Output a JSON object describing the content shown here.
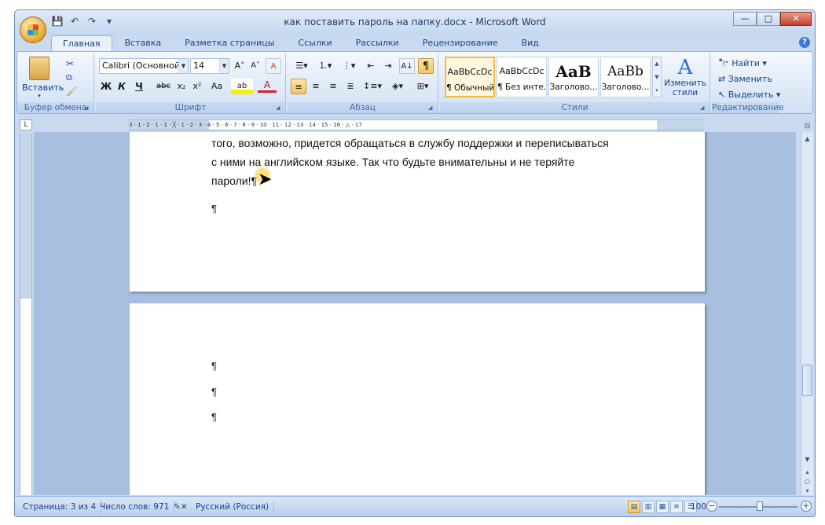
{
  "window": {
    "title": "как поставить пароль на папку.docx - Microsoft Word",
    "controls": {
      "minimize": "—",
      "maximize": "□",
      "close": "✕"
    }
  },
  "qat": {
    "save": "💾",
    "undo": "↶",
    "redo": "↷",
    "more": "▾"
  },
  "tabs": [
    "Главная",
    "Вставка",
    "Разметка страницы",
    "Ссылки",
    "Рассылки",
    "Рецензирование",
    "Вид"
  ],
  "active_tab": "Главная",
  "ribbon": {
    "clipboard": {
      "label": "Буфер обмена",
      "paste": "Вставить"
    },
    "font": {
      "label": "Шрифт",
      "font_name": "Calibri (Основной те",
      "font_size": "14",
      "grow": "A˄",
      "shrink": "A˅",
      "clear": "A",
      "bold": "Ж",
      "italic": "К",
      "underline": "Ч",
      "strike": "abc",
      "subscript": "x₂",
      "superscript": "x²",
      "case": "Aa",
      "highlight": "ab",
      "color": "A"
    },
    "paragraph": {
      "label": "Абзац",
      "show_marks": "¶",
      "sort": "A↓"
    },
    "styles": {
      "label": "Стили",
      "items": [
        {
          "sample": "AaBbCcDc",
          "name": "¶ Обычный"
        },
        {
          "sample": "AaBbCcDc",
          "name": "¶ Без инте..."
        },
        {
          "sample": "AaB",
          "name": "Заголово..."
        },
        {
          "sample": "AaBb",
          "name": "Заголово..."
        }
      ],
      "change": "Изменить стили"
    },
    "editing": {
      "label": "Редактирование",
      "find": "Найти",
      "replace": "Заменить",
      "select": "Выделить"
    }
  },
  "document": {
    "page1_lines": [
      "того, возможно, придется обращаться в службу поддержки и переписываться",
      "с ними на английском языке. Так что будьте внимательны и не теряйте",
      "пароли!¶"
    ],
    "pilcrow": "¶"
  },
  "statusbar": {
    "page": "Страница: 3 из 4",
    "words": "Число слов: 971",
    "language": "Русский (Россия)",
    "zoom": "100%",
    "zoom_level": 1.0
  },
  "ruler": {
    "h_ticks": "3 · 1 · 2 · 1 · 1 · ╳ · 1 · 2 · 3 · 4 · 5 · 6 · 7 · 8 · 9 · 10 · 11 · 12 · 13 · 14 · 15 · 16 · △ · 17"
  }
}
